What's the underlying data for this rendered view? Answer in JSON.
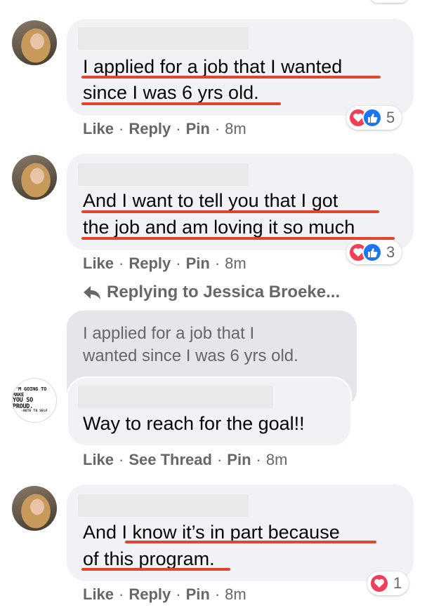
{
  "comments": [
    {
      "lines": [
        "I applied for a job that I wanted",
        "since I was 6 yrs old."
      ],
      "actions": [
        "Like",
        "Reply",
        "Pin"
      ],
      "time": "8m",
      "reaction_count": "5"
    },
    {
      "lines": [
        "And I want to tell you that I got",
        "the job and am loving it so much"
      ],
      "actions": [
        "Like",
        "Reply",
        "Pin"
      ],
      "time": "8m",
      "reaction_count": "3"
    },
    {
      "replying_to": "Replying to Jessica Broeke...",
      "quoted_lines": [
        "I applied for a job that I",
        "wanted since I was 6 yrs old."
      ],
      "avatar_text": [
        "I'M GOING TO MAKE",
        "YOU SO PROUD.",
        "-NOTE TO SELF"
      ],
      "lines": [
        "Way to reach for the goal!!"
      ],
      "actions": [
        "Like",
        "See Thread",
        "Pin"
      ],
      "time": "8m"
    },
    {
      "lines": [
        "And I know it’s in part because",
        "of this program."
      ],
      "actions": [
        "Like",
        "Reply",
        "Pin"
      ],
      "time": "8m",
      "reaction_count": "1"
    }
  ],
  "colors": {
    "bubble": "#f0f2f5",
    "quoted_bubble": "#e4e6eb",
    "underline": "#e0452d",
    "meta_text": "#65676b",
    "love": "#f33e58",
    "like": "#1877f2"
  },
  "icons": [
    "heart-icon",
    "thumbs-up-icon",
    "reply-arrow-icon"
  ]
}
